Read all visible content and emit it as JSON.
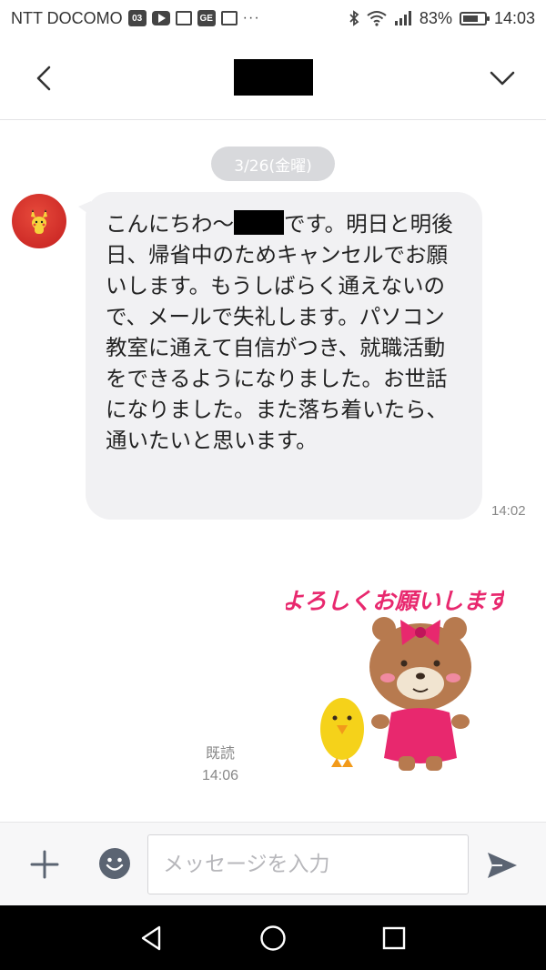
{
  "status_bar": {
    "carrier": "NTT DOCOMO",
    "badge_03": "03",
    "badge_ge": "GE",
    "more": "···",
    "battery_pct": "83%",
    "time": "14:03"
  },
  "header": {
    "back_icon": "chevron-left-icon",
    "chat_name": "",
    "dropdown_icon": "chevron-down-icon"
  },
  "chat": {
    "date_label": "3/26(金曜)",
    "message": {
      "text_before_redaction": "こんにちわ〜",
      "text_after_redaction": "です。明日と明後日、帰省中のためキャンセルでお願いします。もうしばらく通えないので、メールで失礼します。パソコン教室に通えて自信がつき、就職活動をできるようになりました。お世話になりました。また落ち着いたら、通いたいと思います。",
      "time": "14:02"
    },
    "sticker": {
      "caption": "よろしくお願いします"
    },
    "read_label": "既読",
    "read_time": "14:06"
  },
  "input_bar": {
    "placeholder": "メッセージを入力",
    "value": ""
  },
  "colors": {
    "bubble": "#f1f1f3",
    "date_chip": "#d8d9dc",
    "icon": "#5b6472",
    "sticker_text": "#e8286e"
  }
}
